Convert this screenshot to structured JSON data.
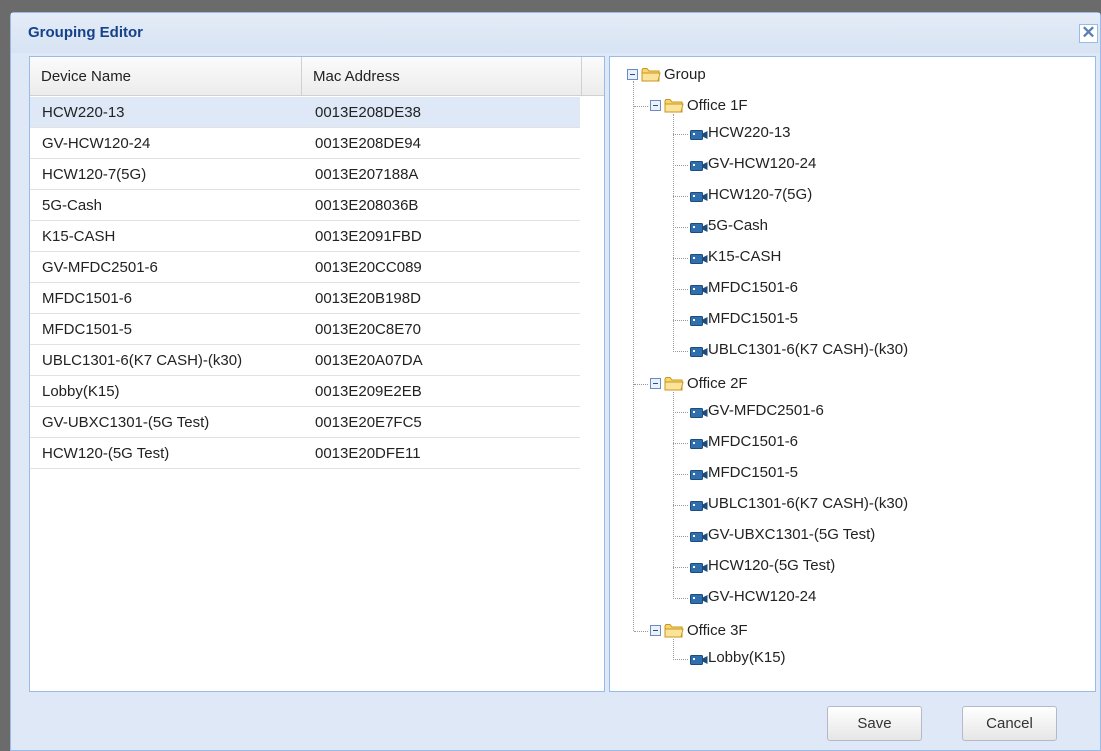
{
  "dialog": {
    "title": "Grouping Editor"
  },
  "grid": {
    "columns": [
      "Device Name",
      "Mac Address"
    ],
    "rows": [
      {
        "name": "HCW220-13",
        "mac": "0013E208DE38",
        "selected": true
      },
      {
        "name": "GV-HCW120-24",
        "mac": "0013E208DE94"
      },
      {
        "name": "HCW120-7(5G)",
        "mac": "0013E207188A"
      },
      {
        "name": "5G-Cash",
        "mac": "0013E208036B"
      },
      {
        "name": "K15-CASH",
        "mac": "0013E2091FBD"
      },
      {
        "name": "GV-MFDC2501-6",
        "mac": "0013E20CC089"
      },
      {
        "name": "MFDC1501-6",
        "mac": "0013E20B198D"
      },
      {
        "name": "MFDC1501-5",
        "mac": "0013E20C8E70"
      },
      {
        "name": "UBLC1301-6(K7 CASH)-(k30)",
        "mac": "0013E20A07DA"
      },
      {
        "name": "Lobby(K15)",
        "mac": "0013E209E2EB"
      },
      {
        "name": "GV-UBXC1301-(5G Test)",
        "mac": "0013E20E7FC5"
      },
      {
        "name": "HCW120-(5G Test)",
        "mac": "0013E20DFE11"
      }
    ]
  },
  "tree": {
    "root": "Group",
    "groups": [
      {
        "label": "Office 1F",
        "devices": [
          "HCW220-13",
          "GV-HCW120-24",
          "HCW120-7(5G)",
          "5G-Cash",
          "K15-CASH",
          "MFDC1501-6",
          "MFDC1501-5",
          "UBLC1301-6(K7 CASH)-(k30)"
        ]
      },
      {
        "label": "Office 2F",
        "devices": [
          "GV-MFDC2501-6",
          "MFDC1501-6",
          "MFDC1501-5",
          "UBLC1301-6(K7 CASH)-(k30)",
          "GV-UBXC1301-(5G Test)",
          "HCW120-(5G Test)",
          "GV-HCW120-24"
        ]
      },
      {
        "label": "Office 3F",
        "devices": [
          "Lobby(K15)"
        ]
      }
    ]
  },
  "buttons": {
    "save": "Save",
    "cancel": "Cancel"
  },
  "close_glyph": "✕",
  "colors": {
    "accent": "#15428b",
    "panel": "#dfe8f6",
    "border": "#99bbe8",
    "camera": "#2f6fae",
    "folder": "#f3c74a"
  }
}
